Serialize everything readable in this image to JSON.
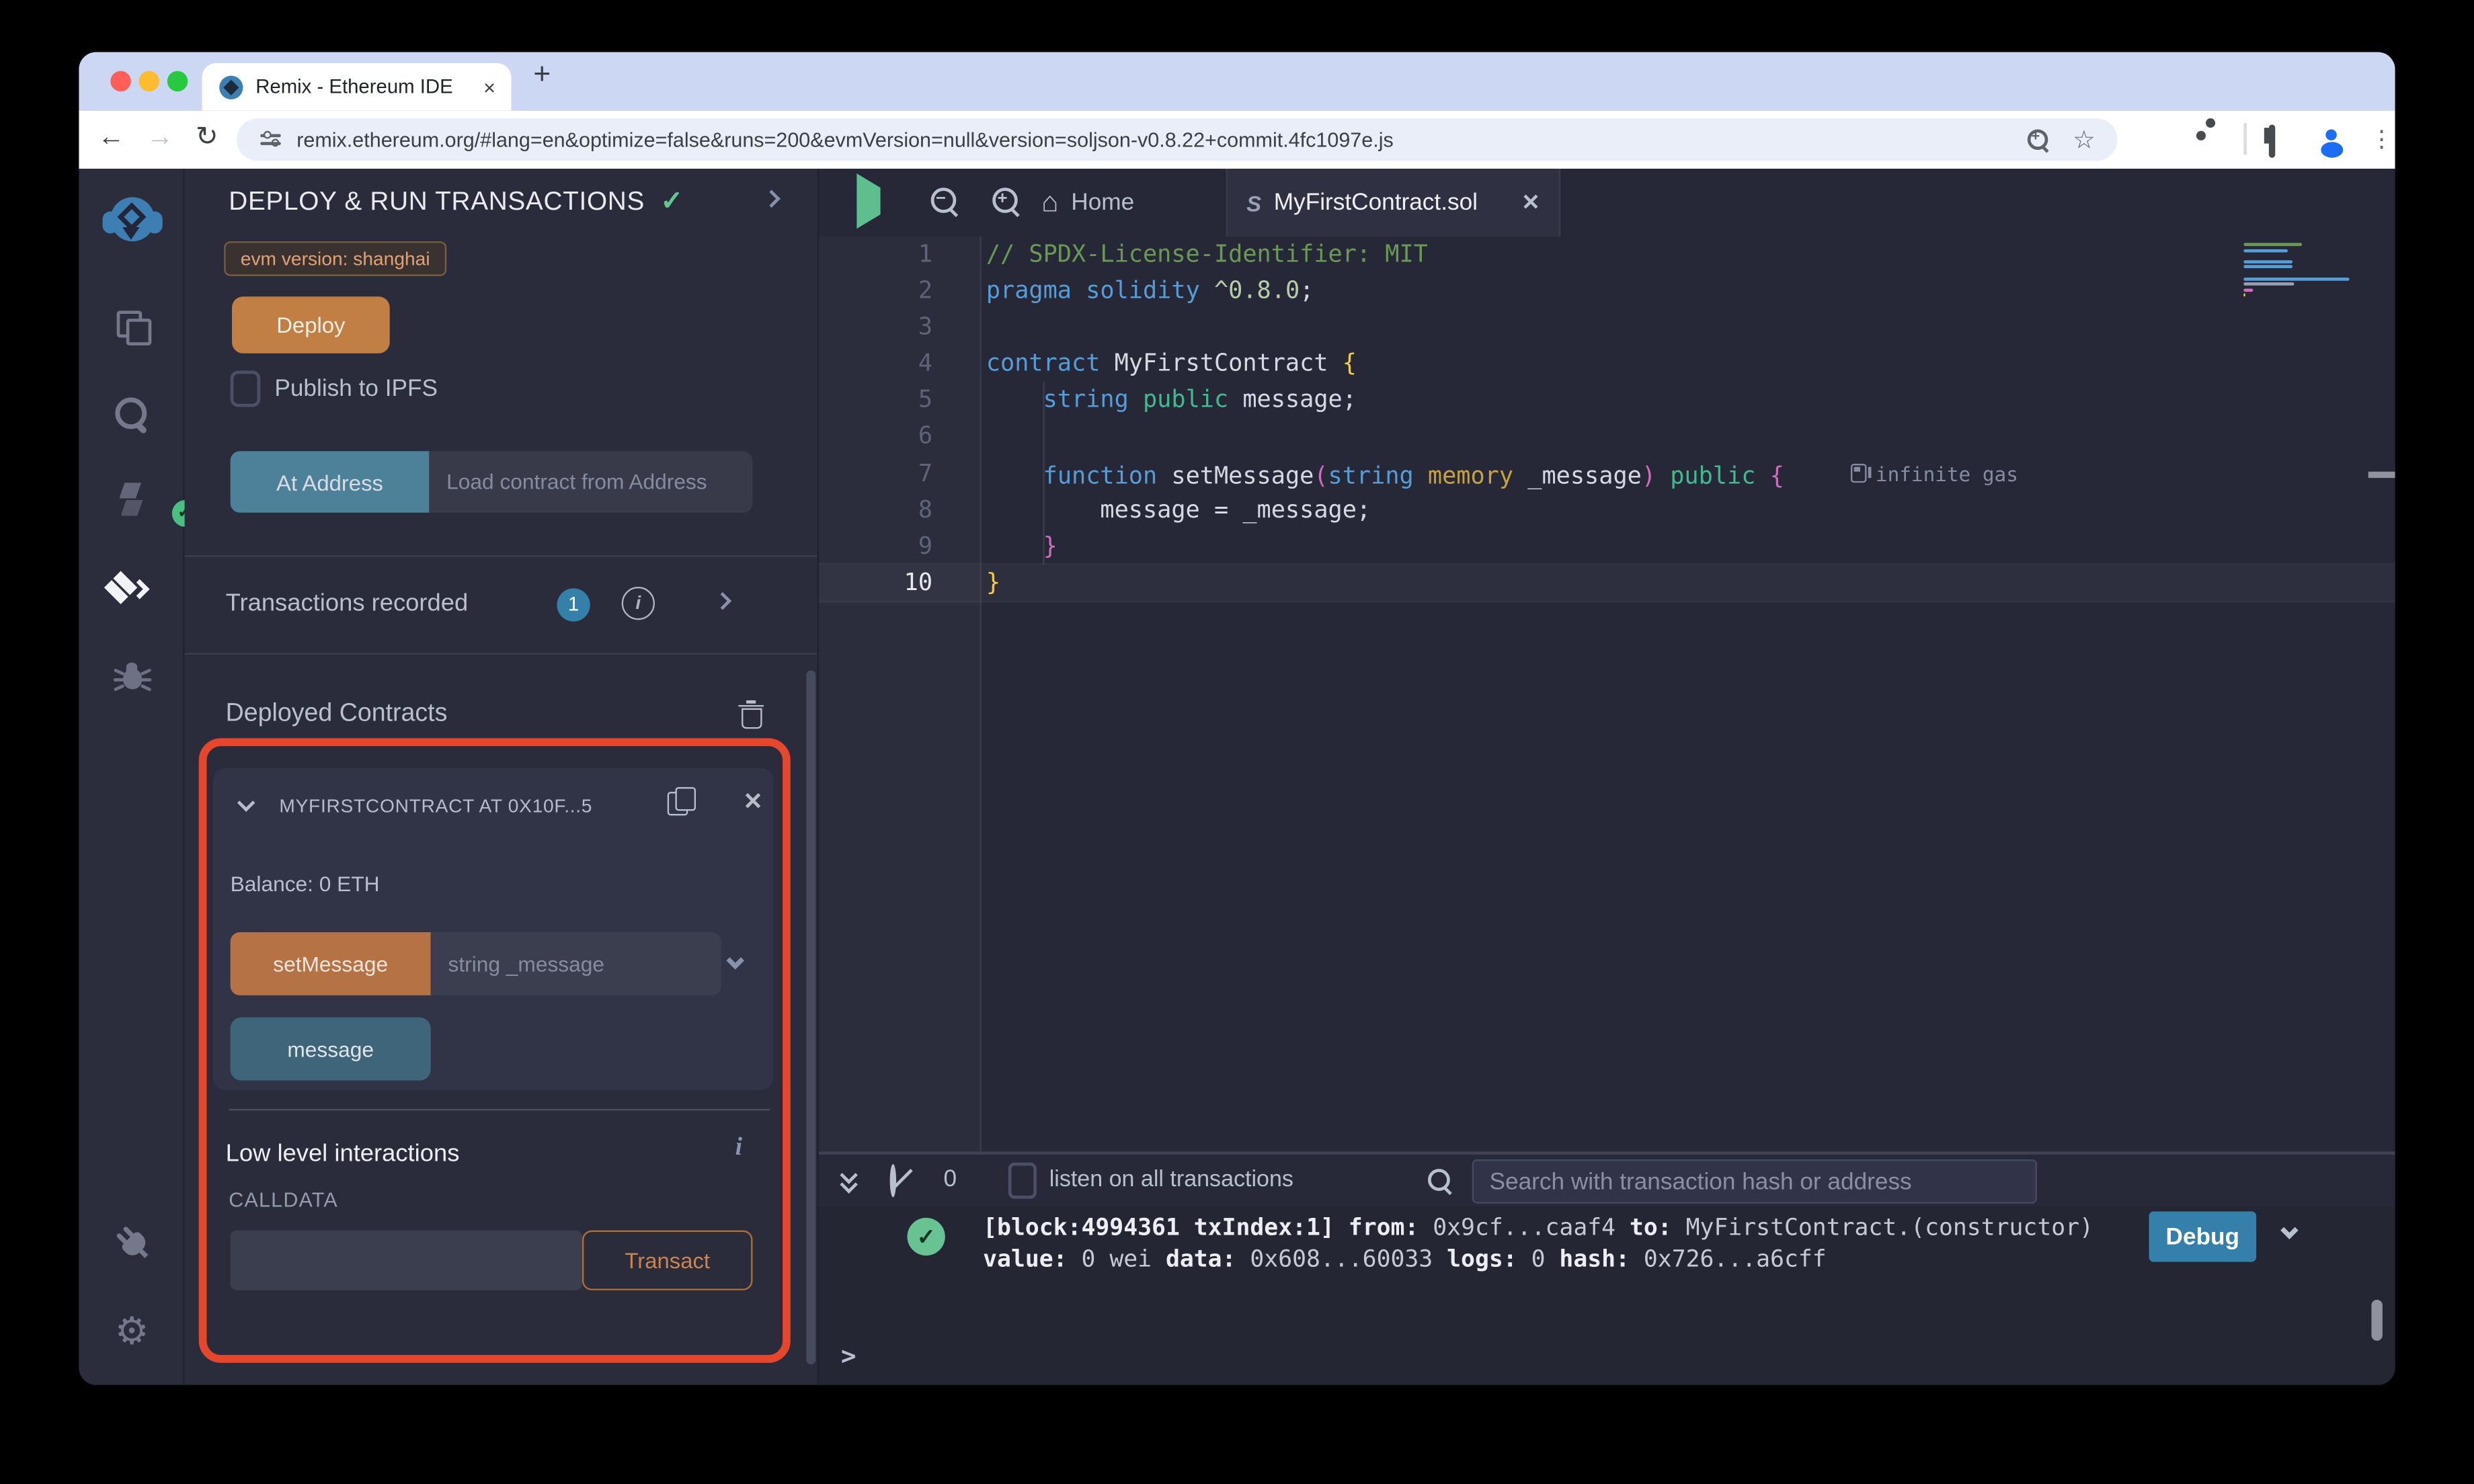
{
  "browser": {
    "tab_title": "Remix - Ethereum IDE",
    "close_tab": "×",
    "new_tab": "+",
    "back": "←",
    "forward": "→",
    "reload": "↻",
    "url": "remix.ethereum.org/#lang=en&optimize=false&runs=200&evmVersion=null&version=soljson-v0.8.22+commit.4fc1097e.js",
    "menu_dots": "⋮",
    "bookmark_star": "☆"
  },
  "rail": {
    "icons": [
      "remix-logo",
      "file-explorer",
      "search",
      "solidity-compiler",
      "deploy-and-run",
      "debugger",
      "plugin-manager",
      "settings"
    ]
  },
  "panel": {
    "title": "DEPLOY & RUN TRANSACTIONS",
    "title_check": "✓",
    "evm_badge": "evm version: shanghai",
    "deploy_label": "Deploy",
    "publish_label": "Publish to IPFS",
    "at_address_label": "At Address",
    "load_contract_placeholder": "Load contract from Address",
    "transactions_recorded": "Transactions recorded",
    "transactions_count": "1",
    "info_i": "i",
    "deployed_contracts": "Deployed Contracts",
    "contract_header": "MYFIRSTCONTRACT AT 0X10F...5",
    "contract_close": "✕",
    "balance": "Balance: 0 ETH",
    "set_message_label": "setMessage",
    "set_message_placeholder": "string _message",
    "message_label": "message",
    "low_level": "Low level interactions",
    "calldata_label": "CALLDATA",
    "transact_label": "Transact"
  },
  "editor": {
    "tab_home": "Home",
    "tab_file": "MyFirstContract.sol",
    "tab_file_close": "✕",
    "gas_annotation": "infinite gas",
    "active_line": 10,
    "lines": [
      {
        "num": 1,
        "tokens": [
          {
            "c": "comment",
            "t": "// SPDX-License-Identifier: MIT"
          }
        ]
      },
      {
        "num": 2,
        "tokens": [
          {
            "c": "kw",
            "t": "pragma"
          },
          {
            "c": "fg",
            "t": " "
          },
          {
            "c": "kw",
            "t": "solidity"
          },
          {
            "c": "fg",
            "t": " "
          },
          {
            "c": "num",
            "t": "^0.8.0"
          },
          {
            "c": "fg",
            "t": ";"
          }
        ]
      },
      {
        "num": 3,
        "tokens": []
      },
      {
        "num": 4,
        "tokens": [
          {
            "c": "kw",
            "t": "contract"
          },
          {
            "c": "fg",
            "t": " MyFirstContract "
          },
          {
            "c": "brace-y",
            "t": "{"
          }
        ]
      },
      {
        "num": 5,
        "tokens": [
          {
            "c": "fg",
            "t": "    "
          },
          {
            "c": "kw",
            "t": "string"
          },
          {
            "c": "fg",
            "t": " "
          },
          {
            "c": "green",
            "t": "public"
          },
          {
            "c": "fg",
            "t": " message;"
          }
        ]
      },
      {
        "num": 6,
        "tokens": []
      },
      {
        "num": 7,
        "gas": true,
        "tokens": [
          {
            "c": "fg",
            "t": "    "
          },
          {
            "c": "kw",
            "t": "function"
          },
          {
            "c": "fg",
            "t": " setMessage"
          },
          {
            "c": "paren",
            "t": "("
          },
          {
            "c": "kw",
            "t": "string"
          },
          {
            "c": "fg",
            "t": " "
          },
          {
            "c": "gold",
            "t": "memory"
          },
          {
            "c": "fg",
            "t": " _message"
          },
          {
            "c": "paren",
            "t": ")"
          },
          {
            "c": "fg",
            "t": " "
          },
          {
            "c": "green",
            "t": "public"
          },
          {
            "c": "fg",
            "t": " "
          },
          {
            "c": "paren",
            "t": "{"
          }
        ]
      },
      {
        "num": 8,
        "tokens": [
          {
            "c": "fg",
            "t": "        message = _message;"
          }
        ]
      },
      {
        "num": 9,
        "tokens": [
          {
            "c": "fg",
            "t": "    "
          },
          {
            "c": "paren",
            "t": "}"
          }
        ]
      },
      {
        "num": 10,
        "tokens": [
          {
            "c": "brace-y",
            "t": "}"
          }
        ]
      }
    ]
  },
  "terminal": {
    "badge_count": "0",
    "listen_label": "listen on all transactions",
    "search_placeholder": "Search with transaction hash or address",
    "status_check": "✓",
    "log_lines": [
      [
        {
          "t": "[block:4994361 txIndex:1]",
          "b": true
        },
        {
          "t": " ",
          "b": false
        },
        {
          "t": "from:",
          "b": true
        },
        {
          "t": " 0x9cf...caaf4 ",
          "b": false
        },
        {
          "t": "to:",
          "b": true
        },
        {
          "t": " MyFirstContract.(constructor)",
          "b": false
        }
      ],
      [
        {
          "t": "value:",
          "b": true
        },
        {
          "t": " 0 wei ",
          "b": false
        },
        {
          "t": "data:",
          "b": true
        },
        {
          "t": " 0x608...60033 ",
          "b": false
        },
        {
          "t": "logs:",
          "b": true
        },
        {
          "t": " 0 ",
          "b": false
        },
        {
          "t": "hash:",
          "b": true
        },
        {
          "t": " 0x726...a6cff",
          "b": false
        }
      ]
    ],
    "debug_label": "Debug",
    "prompt": ">"
  },
  "colors": {
    "accent_orange": "#c17f43",
    "red_outline": "#e5472d",
    "teal_button": "#4d8099",
    "steel_button": "#3f657b",
    "debug_blue": "#3480ab",
    "success_green": "#63c58f"
  }
}
